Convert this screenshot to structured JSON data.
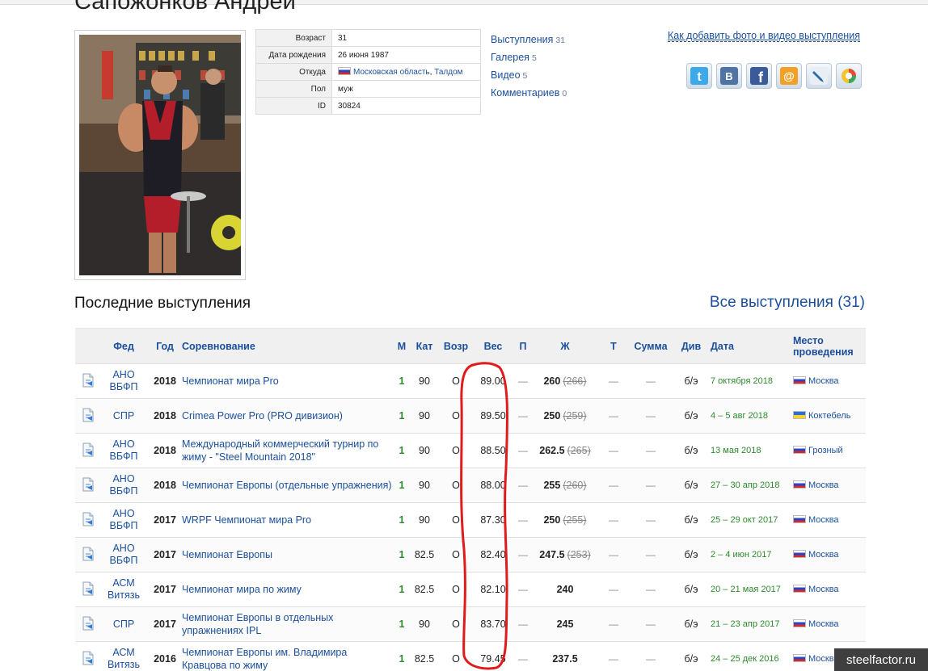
{
  "header": {
    "athlete_name": "Сапожонков Андрей"
  },
  "profile": {
    "photo_alt": "",
    "info": [
      {
        "key": "Возраст",
        "value": "31"
      },
      {
        "key": "Дата рождения",
        "value": "26 июня 1987"
      },
      {
        "key": "Откуда",
        "value": "",
        "links": [
          "Московская область",
          "Талдом"
        ],
        "flag": "ru"
      },
      {
        "key": "Пол",
        "value": "муж"
      },
      {
        "key": "ID",
        "value": "30824"
      }
    ],
    "side_links": [
      {
        "label": "Выступления",
        "count": "31"
      },
      {
        "label": "Галерея",
        "count": "5"
      },
      {
        "label": "Видео",
        "count": "5"
      },
      {
        "label": "Комментариев",
        "count": "0"
      }
    ],
    "howto_link": "Как добавить фото и видео выступления",
    "share_icons": [
      "twitter-icon",
      "vkontakte-icon",
      "facebook-icon",
      "mailru-icon",
      "livejournal-icon",
      "google-buzz-icon"
    ]
  },
  "section": {
    "title": "Последние выступления",
    "all_link": "Все выступления (31)"
  },
  "table": {
    "headers": [
      "",
      "Фед",
      "Год",
      "Соревнование",
      "М",
      "Кат",
      "Возр",
      "Вес",
      "П",
      "Ж",
      "Т",
      "Сумма",
      "Див",
      "Дата",
      "Место проведения"
    ],
    "rows": [
      {
        "fed": "АНО ВБФП",
        "year": "2018",
        "comp": "Чемпионат мира Pro",
        "place": "1",
        "cat": "90",
        "age": "О",
        "weight": "89.00",
        "squat": "—",
        "bench": "260",
        "bench_fail": "266",
        "dead": "—",
        "total": "—",
        "div": "б/э",
        "date": "7 октября 2018",
        "flag": "ru",
        "venue": "Москва"
      },
      {
        "fed": "СПР",
        "year": "2018",
        "comp": "Crimea Power Pro (PRO дивизион)",
        "place": "1",
        "cat": "90",
        "age": "О",
        "weight": "89.50",
        "squat": "—",
        "bench": "250",
        "bench_fail": "259",
        "dead": "—",
        "total": "—",
        "div": "б/э",
        "date": "4 – 5 авг 2018",
        "flag": "ua",
        "venue": "Коктебель"
      },
      {
        "fed": "АНО ВБФП",
        "year": "2018",
        "comp": "Международный коммерческий турнир по жиму - \"Steel Mountain 2018\"",
        "place": "1",
        "cat": "90",
        "age": "О",
        "weight": "88.50",
        "squat": "—",
        "bench": "262.5",
        "bench_fail": "265",
        "dead": "—",
        "total": "—",
        "div": "б/э",
        "date": "13 мая 2018",
        "flag": "ru",
        "venue": "Грозный"
      },
      {
        "fed": "АНО ВБФП",
        "year": "2018",
        "comp": "Чемпионат Европы (отдельные упражнения)",
        "place": "1",
        "cat": "90",
        "age": "О",
        "weight": "88.00",
        "squat": "—",
        "bench": "255",
        "bench_fail": "260",
        "dead": "—",
        "total": "—",
        "div": "б/э",
        "date": "27 – 30 апр 2018",
        "flag": "ru",
        "venue": "Москва"
      },
      {
        "fed": "АНО ВБФП",
        "year": "2017",
        "comp": "WRPF Чемпионат мира Pro",
        "place": "1",
        "cat": "90",
        "age": "О",
        "weight": "87.30",
        "squat": "—",
        "bench": "250",
        "bench_fail": "255",
        "dead": "—",
        "total": "—",
        "div": "б/э",
        "date": "25 – 29 окт 2017",
        "flag": "ru",
        "venue": "Москва"
      },
      {
        "fed": "АНО ВБФП",
        "year": "2017",
        "comp": "Чемпионат Европы",
        "place": "1",
        "cat": "82.5",
        "age": "О",
        "weight": "82.40",
        "squat": "—",
        "bench": "247.5",
        "bench_fail": "253",
        "dead": "—",
        "total": "—",
        "div": "б/э",
        "date": "2 – 4 июн 2017",
        "flag": "ru",
        "venue": "Москва"
      },
      {
        "fed": "АСМ Витязь",
        "year": "2017",
        "comp": "Чемпионат мира по жиму",
        "place": "1",
        "cat": "82.5",
        "age": "О",
        "weight": "82.10",
        "squat": "—",
        "bench": "240",
        "bench_fail": "",
        "dead": "—",
        "total": "—",
        "div": "б/э",
        "date": "20 – 21 мая 2017",
        "flag": "ru",
        "venue": "Москва"
      },
      {
        "fed": "СПР",
        "year": "2017",
        "comp": "Чемпионат Европы в отдельных упражнениях IPL",
        "place": "1",
        "cat": "90",
        "age": "О",
        "weight": "83.70",
        "squat": "—",
        "bench": "245",
        "bench_fail": "",
        "dead": "—",
        "total": "—",
        "div": "б/э",
        "date": "21 – 23 апр 2017",
        "flag": "ru",
        "venue": "Москва"
      },
      {
        "fed": "АСМ Витязь",
        "year": "2016",
        "comp": "Чемпионат Европы им. Владимира Кравцова по жиму",
        "place": "1",
        "cat": "82.5",
        "age": "О",
        "weight": "79.45",
        "squat": "—",
        "bench": "237.5",
        "bench_fail": "",
        "dead": "—",
        "total": "—",
        "div": "б/э",
        "date": "24 – 25 дек 2016",
        "flag": "ru",
        "venue": "Москва"
      }
    ]
  },
  "watermark": "steelfactor.ru",
  "colors": {
    "link": "#1b4f9c",
    "place": "#2c8a2c",
    "highlight_loop": "#e01b1b"
  }
}
